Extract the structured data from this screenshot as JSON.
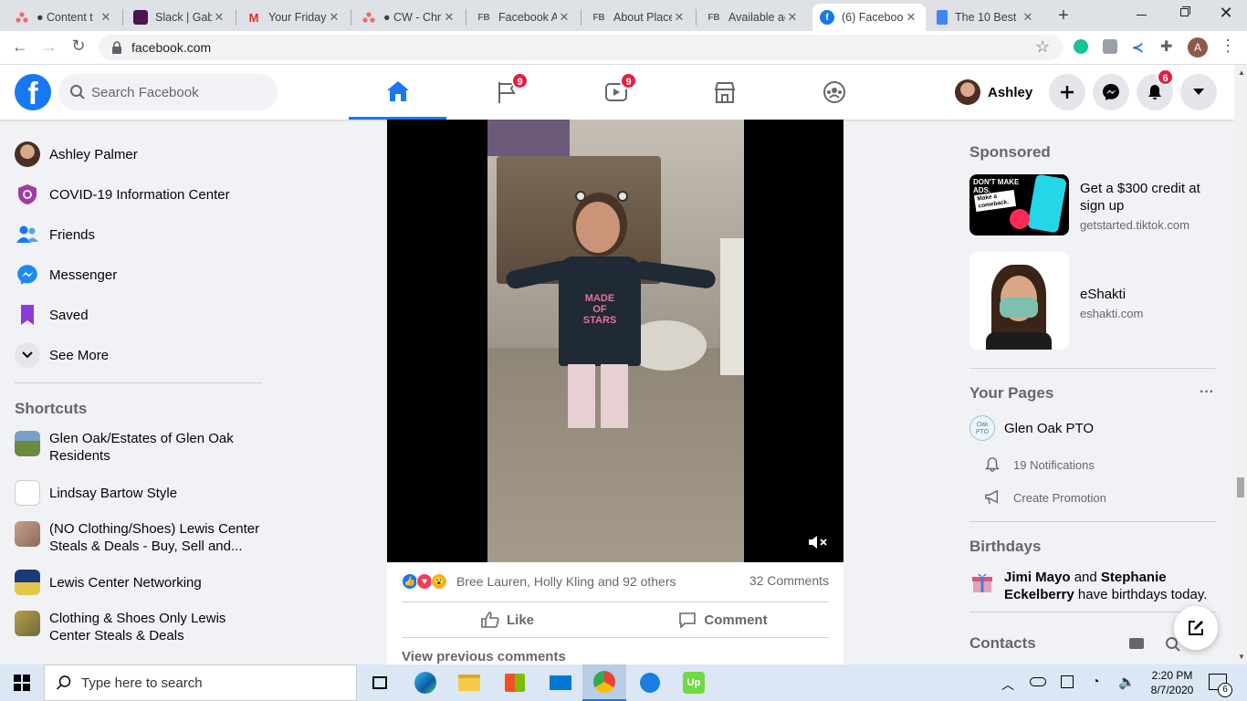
{
  "browser": {
    "tabs": [
      {
        "title": "● Content t",
        "favicon": "asana-icon",
        "color": "#f06a6a"
      },
      {
        "title": "Slack | Gabe",
        "favicon": "slack-icon",
        "color": "#4a154b"
      },
      {
        "title": "Your Friday",
        "favicon": "gmail-icon",
        "color": "#d93025"
      },
      {
        "title": "● CW - Chri",
        "favicon": "asana-icon",
        "color": "#f06a6a"
      },
      {
        "title": "Facebook A",
        "favicon": "fb-text-icon",
        "color": "#5f6368"
      },
      {
        "title": "About Place",
        "favicon": "fb-text-icon",
        "color": "#5f6368"
      },
      {
        "title": "Available ac",
        "favicon": "fb-text-icon",
        "color": "#5f6368"
      },
      {
        "title": "(6) Faceboo",
        "favicon": "facebook-icon",
        "color": "#1877f2"
      },
      {
        "title": "The 10 Best",
        "favicon": "docs-icon",
        "color": "#4285f4"
      }
    ],
    "fb_favicon_text": "FB",
    "new_tab": "+",
    "url": "facebook.com",
    "profile_initial": "A"
  },
  "fb": {
    "logo": "f",
    "search_placeholder": "Search Facebook",
    "nav_badges": {
      "pages": "9",
      "watch": "9"
    },
    "user_name": "Ashley",
    "notif_badge": "6"
  },
  "sidebar": {
    "items": [
      {
        "label": "Ashley Palmer",
        "icon": "avatar"
      },
      {
        "label": "COVID-19 Information Center",
        "icon": "covid-icon"
      },
      {
        "label": "Friends",
        "icon": "friends-icon"
      },
      {
        "label": "Messenger",
        "icon": "messenger-icon"
      },
      {
        "label": "Saved",
        "icon": "saved-icon"
      },
      {
        "label": "See More",
        "icon": "chevron-down-icon"
      }
    ],
    "shortcuts_title": "Shortcuts",
    "shortcuts": [
      {
        "label": "Glen Oak/Estates of Glen Oak Residents"
      },
      {
        "label": "Lindsay Bartow Style"
      },
      {
        "label": "(NO Clothing/Shoes) Lewis Center Steals & Deals - Buy, Sell and..."
      },
      {
        "label": "Lewis Center Networking"
      },
      {
        "label": "Clothing & Shoes Only Lewis Center Steals & Deals"
      }
    ]
  },
  "post": {
    "shirt_text": [
      "MADE",
      "OF",
      "STARS"
    ],
    "reactions_text": "Bree Lauren, Holly Kling and 92 others",
    "comments_count": "32 Comments",
    "like_label": "Like",
    "comment_label": "Comment",
    "view_previous": "View previous comments"
  },
  "right": {
    "sponsored_title": "Sponsored",
    "ads": [
      {
        "title": "Get a $300 credit at sign up",
        "domain": "getstarted.tiktok.com",
        "image_text": "DON'T MAKE ADS.",
        "image_sticker": "Make a comeback."
      },
      {
        "title": "eShakti",
        "domain": "eshakti.com"
      }
    ],
    "your_pages_title": "Your Pages",
    "more": "···",
    "page_name": "Glen Oak PTO",
    "page_logo_text": "Oak PTO",
    "notifications": "19 Notifications",
    "create_promotion": "Create Promotion",
    "birthdays_title": "Birthdays",
    "birthday_name1": "Jimi Mayo",
    "birthday_and": " and ",
    "birthday_name2": "Stephanie Eckelberry",
    "birthday_rest": " have birthdays today.",
    "contacts_title": "Contacts"
  },
  "taskbar": {
    "search_placeholder": "Type here to search",
    "time": "2:20 PM",
    "date": "8/7/2020",
    "notif_count": "6",
    "upwork": "Up"
  }
}
